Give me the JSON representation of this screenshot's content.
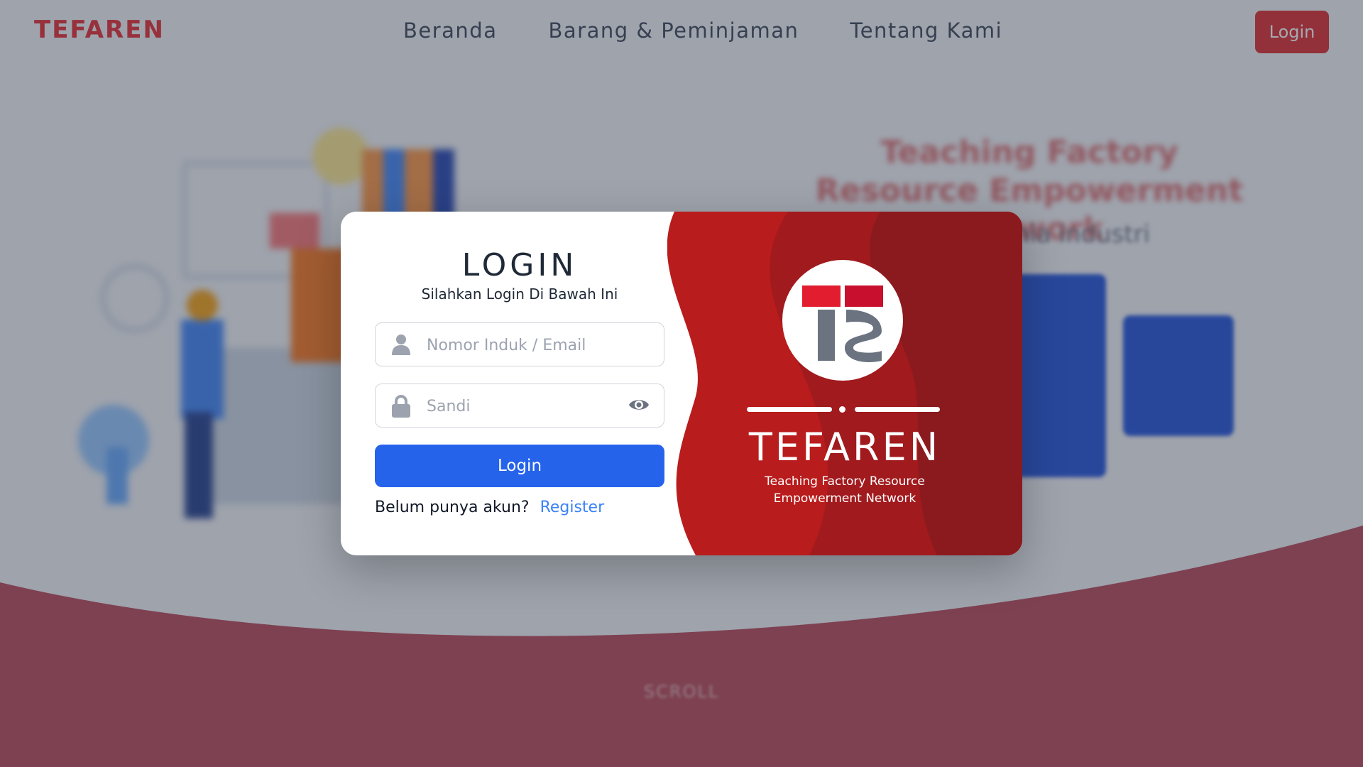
{
  "nav": {
    "brand": "TEFAREN",
    "links": [
      "Beranda",
      "Barang & Peminjaman",
      "Tentang Kami"
    ],
    "login_label": "Login"
  },
  "hero": {
    "title": "Teaching Factory Resource Empowerment Network",
    "subtitle": "pada dunia industri",
    "scroll_label": "SCROLL"
  },
  "login": {
    "title": "LOGIN",
    "subtitle": "Silahkan Login Di Bawah Ini",
    "username_placeholder": "Nomor Induk / Email",
    "password_placeholder": "Sandi",
    "submit_label": "Login",
    "register_prompt": "Belum punya akun?",
    "register_label": "Register"
  },
  "panel": {
    "title": "TEFAREN",
    "tagline": "Teaching Factory Resource Empowerment Network"
  },
  "icons": {
    "username": "user-icon",
    "password": "lock-icon",
    "toggle": "eye-icon",
    "logo": "tefaren-logo"
  },
  "colors": {
    "brand_red": "#dc2626",
    "panel_red": "#b91c1c",
    "panel_red_dark": "#8b1a1e",
    "primary_blue": "#2563eb",
    "link_blue": "#3b82f6",
    "footer_wave": "#7a2e37"
  }
}
